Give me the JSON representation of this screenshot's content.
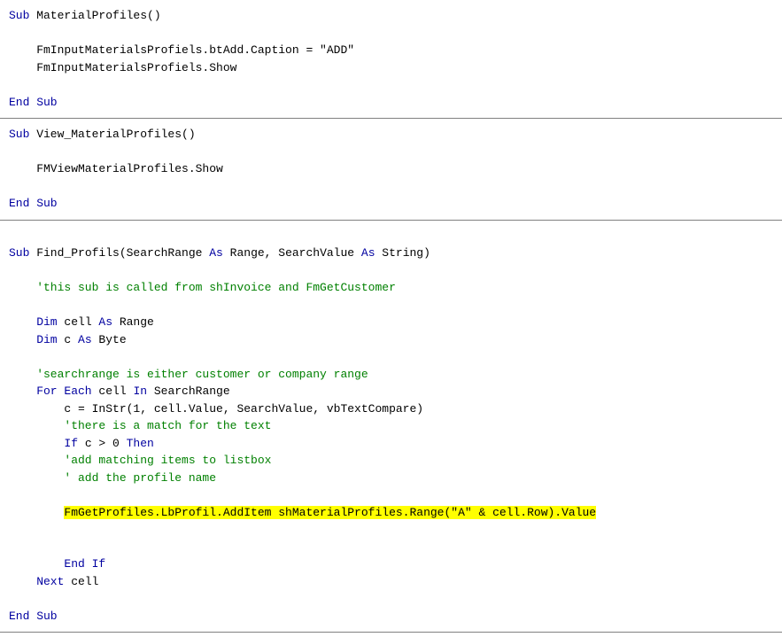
{
  "b1": {
    "l1_kw": "Sub",
    "l1_name": " MaterialProfiles()",
    "l2": "FmInputMaterialsProfiels.btAdd.Caption = \"ADD\"",
    "l3": "FmInputMaterialsProfiels.Show",
    "l4_kw": "End Sub"
  },
  "b2": {
    "l1_kw": "Sub",
    "l1_name": " View_MaterialProfiles()",
    "l2": "FMViewMaterialProfiles.Show",
    "l3_kw": "End Sub"
  },
  "b3": {
    "l1_kw": "Sub",
    "l1_name": " Find_Profils(SearchRange ",
    "l1_as1": "As",
    "l1_r1": " Range, SearchValue ",
    "l1_as2": "As",
    "l1_r2": " String)",
    "c1": "'this sub is called from shInvoice and FmGetCustomer",
    "dim1_k": "Dim",
    "dim1_n": " cell ",
    "dim1_as": "As",
    "dim1_t": " Range",
    "dim2_k": "Dim",
    "dim2_n": " c ",
    "dim2_as": "As",
    "dim2_t": " Byte",
    "c2": "'searchrange is either customer or company range",
    "for_k1": "For Each",
    "for_n1": " cell ",
    "for_k2": "In",
    "for_n2": " SearchRange",
    "l_instr": "c = InStr(1, cell.Value, SearchValue, vbTextCompare)",
    "c3": "'there is a match for the text",
    "if_k": "If",
    "if_n": " c > 0 ",
    "if_then": "Then",
    "c4": "'add matching items to listbox",
    "c5": "' add the profile name",
    "hl": "FmGetProfiles.LbProfil.AddItem shMaterialProfiles.Range(\"A\" & cell.Row).Value",
    "endif": "End If",
    "next_k": "Next",
    "next_n": " cell",
    "endsub": "End Sub"
  }
}
